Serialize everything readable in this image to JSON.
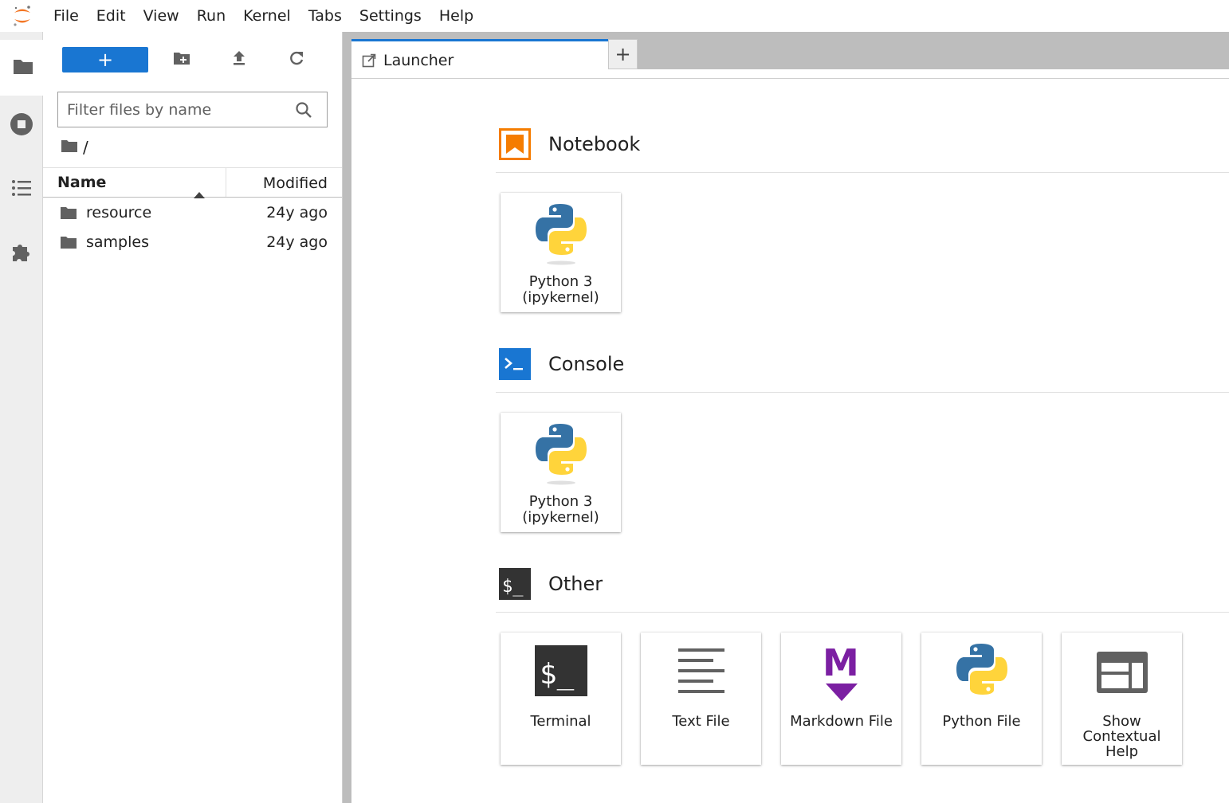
{
  "menu": {
    "items": [
      {
        "label": "File"
      },
      {
        "label": "Edit"
      },
      {
        "label": "View"
      },
      {
        "label": "Run"
      },
      {
        "label": "Kernel"
      },
      {
        "label": "Tabs"
      },
      {
        "label": "Settings"
      },
      {
        "label": "Help"
      }
    ]
  },
  "filebrowser": {
    "new_button_label": "+",
    "filter_placeholder": "Filter files by name",
    "breadcrumb_path": "/",
    "header": {
      "name": "Name",
      "modified": "Modified"
    },
    "files": [
      {
        "name": "resource",
        "modified": "24y ago"
      },
      {
        "name": "samples",
        "modified": "24y ago"
      }
    ]
  },
  "tabs": {
    "active_label": "Launcher",
    "add_label": "+"
  },
  "launcher": {
    "notebook": {
      "title": "Notebook",
      "cards": [
        {
          "label_line1": "Python 3",
          "label_line2": "(ipykernel)"
        }
      ]
    },
    "console": {
      "title": "Console",
      "cards": [
        {
          "label_line1": "Python 3",
          "label_line2": "(ipykernel)"
        }
      ]
    },
    "other": {
      "title": "Other",
      "cards": [
        {
          "label": "Terminal"
        },
        {
          "label": "Text File"
        },
        {
          "label": "Markdown File"
        },
        {
          "label": "Python File"
        },
        {
          "label_line1": "Show",
          "label_line2": "Contextual",
          "label_line3": "Help"
        }
      ]
    }
  },
  "colors": {
    "accent": "#1976d2",
    "notebook_orange": "#f57c00",
    "markdown_purple": "#7b1fa2",
    "python_blue": "#3572a5",
    "python_yellow": "#ffd43b"
  }
}
